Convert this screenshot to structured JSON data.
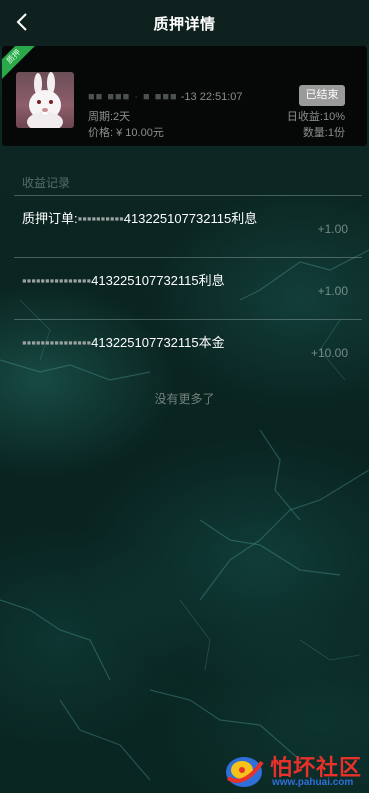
{
  "header": {
    "title": "质押详情"
  },
  "product": {
    "ribbon": "质押",
    "name_line": "-13 22:51:07",
    "status": "已结束",
    "period": "周期:2天",
    "daily_yield": "日收益:10%",
    "price": "价格: ¥ 10.00元",
    "quantity": "数量:1份"
  },
  "records": {
    "label": "收益记录",
    "items": [
      {
        "prefix": "质押订单:",
        "order_suffix": "413225107732115",
        "type": "利息",
        "amount": "+1.00"
      },
      {
        "prefix": "",
        "order_suffix": "413225107732115",
        "type": "利息",
        "amount": "+1.00"
      },
      {
        "prefix": "",
        "order_suffix": "413225107732115",
        "type": "本金",
        "amount": "+10.00"
      }
    ],
    "no_more": "没有更多了"
  },
  "watermark": {
    "text": "怕坏社区",
    "url": "www.pahuai.com"
  },
  "colors": {
    "background": "#0b2521",
    "ribbon": "#2aa84a",
    "badge": "#9a9a9a",
    "watermark_red": "#e8312a",
    "watermark_blue": "#2f6fd8"
  }
}
